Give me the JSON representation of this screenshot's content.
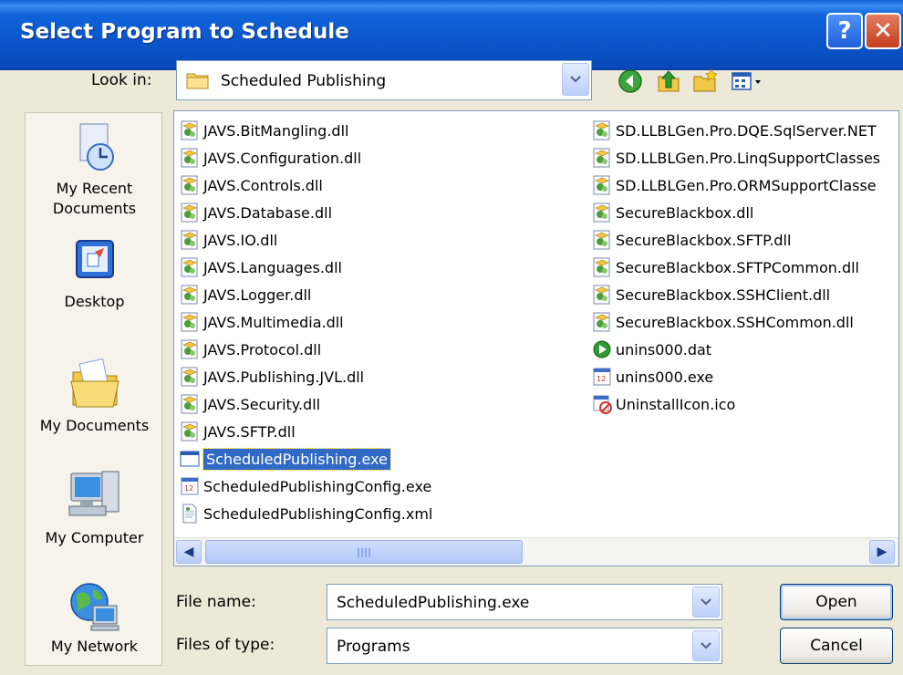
{
  "window": {
    "title": "Select Program to Schedule",
    "help_label": "?",
    "close_label": "✕"
  },
  "lookin": {
    "label": "Look in:",
    "value": "Scheduled Publishing"
  },
  "toolbar": {
    "icons": [
      "back-icon",
      "up-folder-icon",
      "new-folder-icon",
      "views-menu-icon"
    ]
  },
  "places": [
    {
      "label_line1": "My Recent",
      "label_line2": "Documents",
      "icon": "recent-documents-icon"
    },
    {
      "label_line1": "Desktop",
      "label_line2": "",
      "icon": "desktop-icon"
    },
    {
      "label_line1": "My Documents",
      "label_line2": "",
      "icon": "my-documents-icon"
    },
    {
      "label_line1": "My Computer",
      "label_line2": "",
      "icon": "my-computer-icon"
    },
    {
      "label_line1": "My Network",
      "label_line2": "",
      "icon": "my-network-icon"
    }
  ],
  "files": {
    "column1": [
      {
        "name": "JAVS.BitMangling.dll",
        "type": "dll"
      },
      {
        "name": "JAVS.Configuration.dll",
        "type": "dll"
      },
      {
        "name": "JAVS.Controls.dll",
        "type": "dll"
      },
      {
        "name": "JAVS.Database.dll",
        "type": "dll"
      },
      {
        "name": "JAVS.IO.dll",
        "type": "dll"
      },
      {
        "name": "JAVS.Languages.dll",
        "type": "dll"
      },
      {
        "name": "JAVS.Logger.dll",
        "type": "dll"
      },
      {
        "name": "JAVS.Multimedia.dll",
        "type": "dll"
      },
      {
        "name": "JAVS.Protocol.dll",
        "type": "dll"
      },
      {
        "name": "JAVS.Publishing.JVL.dll",
        "type": "dll"
      },
      {
        "name": "JAVS.Security.dll",
        "type": "dll"
      },
      {
        "name": "JAVS.SFTP.dll",
        "type": "dll"
      },
      {
        "name": "ScheduledPublishing.exe",
        "type": "exe-window",
        "selected": true
      },
      {
        "name": "ScheduledPublishingConfig.exe",
        "type": "exe"
      },
      {
        "name": "ScheduledPublishingConfig.xml",
        "type": "xml"
      }
    ],
    "column2": [
      {
        "name": "SD.LLBLGen.Pro.DQE.SqlServer.NET",
        "type": "dll"
      },
      {
        "name": "SD.LLBLGen.Pro.LinqSupportClasses",
        "type": "dll"
      },
      {
        "name": "SD.LLBLGen.Pro.ORMSupportClasse",
        "type": "dll"
      },
      {
        "name": "SecureBlackbox.dll",
        "type": "dll"
      },
      {
        "name": "SecureBlackbox.SFTP.dll",
        "type": "dll"
      },
      {
        "name": "SecureBlackbox.SFTPCommon.dll",
        "type": "dll"
      },
      {
        "name": "SecureBlackbox.SSHClient.dll",
        "type": "dll"
      },
      {
        "name": "SecureBlackbox.SSHCommon.dll",
        "type": "dll"
      },
      {
        "name": "unins000.dat",
        "type": "dat"
      },
      {
        "name": "unins000.exe",
        "type": "exe"
      },
      {
        "name": "UninstallIcon.ico",
        "type": "ico"
      }
    ]
  },
  "scrollbar": {
    "left_arrow": "◀",
    "right_arrow": "▶"
  },
  "filename": {
    "label": "File name:",
    "value": "ScheduledPublishing.exe"
  },
  "filetype": {
    "label": "Files of type:",
    "value": "Programs"
  },
  "buttons": {
    "open": "Open",
    "cancel": "Cancel"
  }
}
